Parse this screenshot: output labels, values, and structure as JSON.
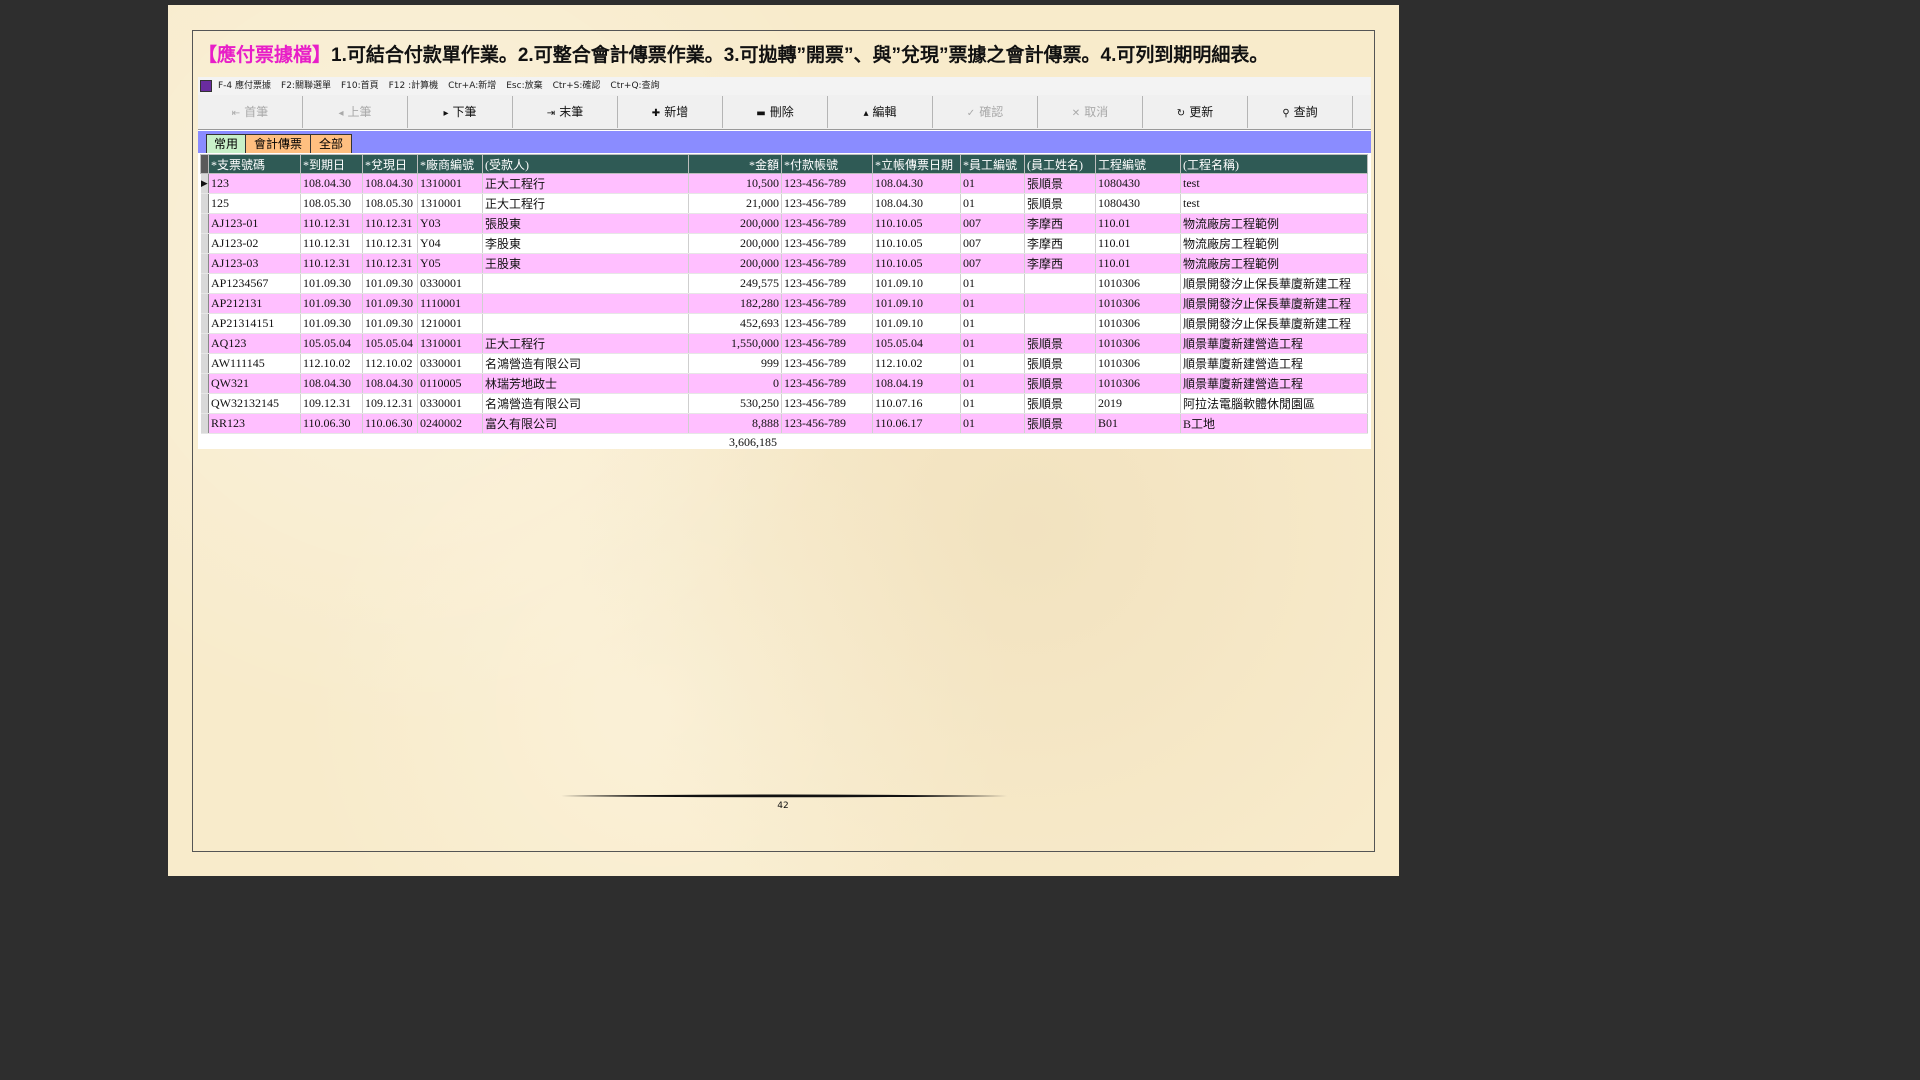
{
  "headline": {
    "tag": "【應付票據檔】",
    "text": "1.可結合付款單作業。2.可整合會計傳票作業。3.可拋轉”開票”、與”兌現”票據之會計傳票。4.可列到期明細表。"
  },
  "app_title": [
    "F-4 應付票據",
    "F2:關聯選單",
    "F10:首頁",
    "F12 :計算機",
    "Ctr+A:新增",
    "Esc:放棄",
    "Ctr+S:確認",
    "Ctr+Q:查詢"
  ],
  "toolbar": [
    {
      "label": "首筆",
      "icon": "⇤",
      "enabled": false
    },
    {
      "label": "上筆",
      "icon": "◂",
      "enabled": false
    },
    {
      "label": "下筆",
      "icon": "▸",
      "enabled": true
    },
    {
      "label": "末筆",
      "icon": "⇥",
      "enabled": true
    },
    {
      "label": "新增",
      "icon": "✚",
      "enabled": true
    },
    {
      "label": "刪除",
      "icon": "▬",
      "enabled": true
    },
    {
      "label": "編輯",
      "icon": "▴",
      "enabled": true
    },
    {
      "label": "確認",
      "icon": "✓",
      "enabled": false
    },
    {
      "label": "取消",
      "icon": "✕",
      "enabled": false
    },
    {
      "label": "更新",
      "icon": "↻",
      "enabled": true
    },
    {
      "label": "查詢",
      "icon": "⚲",
      "enabled": true
    }
  ],
  "tabs": [
    {
      "label": "常用",
      "active": true
    },
    {
      "label": "會計傳票",
      "active": false
    },
    {
      "label": "全部",
      "active": false
    }
  ],
  "columns": [
    "*支票號碼",
    "*到期日",
    "*兌現日",
    "*廠商編號",
    "(受款人)",
    "*金額",
    "*付款帳號",
    "*立帳傳票日期",
    "*員工編號",
    "(員工姓名)",
    "工程編號",
    "(工程名稱)"
  ],
  "rows": [
    [
      "123",
      "108.04.30",
      "108.04.30",
      "1310001",
      "正大工程行",
      "10,500",
      "123-456-789",
      "108.04.30",
      "01",
      "張順景",
      "1080430",
      "test"
    ],
    [
      "125",
      "108.05.30",
      "108.05.30",
      "1310001",
      "正大工程行",
      "21,000",
      "123-456-789",
      "108.04.30",
      "01",
      "張順景",
      "1080430",
      "test"
    ],
    [
      "AJ123-01",
      "110.12.31",
      "110.12.31",
      "Y03",
      "張股東",
      "200,000",
      "123-456-789",
      "110.10.05",
      "007",
      "李摩西",
      "110.01",
      "物流廠房工程範例"
    ],
    [
      "AJ123-02",
      "110.12.31",
      "110.12.31",
      "Y04",
      "李股東",
      "200,000",
      "123-456-789",
      "110.10.05",
      "007",
      "李摩西",
      "110.01",
      "物流廠房工程範例"
    ],
    [
      "AJ123-03",
      "110.12.31",
      "110.12.31",
      "Y05",
      "王股東",
      "200,000",
      "123-456-789",
      "110.10.05",
      "007",
      "李摩西",
      "110.01",
      "物流廠房工程範例"
    ],
    [
      "AP1234567",
      "101.09.30",
      "101.09.30",
      "0330001",
      "",
      "249,575",
      "123-456-789",
      "101.09.10",
      "01",
      "",
      "1010306",
      "順景開發汐止保長華廈新建工程"
    ],
    [
      "AP212131",
      "101.09.30",
      "101.09.30",
      "1110001",
      "",
      "182,280",
      "123-456-789",
      "101.09.10",
      "01",
      "",
      "1010306",
      "順景開發汐止保長華廈新建工程"
    ],
    [
      "AP21314151",
      "101.09.30",
      "101.09.30",
      "1210001",
      "",
      "452,693",
      "123-456-789",
      "101.09.10",
      "01",
      "",
      "1010306",
      "順景開發汐止保長華廈新建工程"
    ],
    [
      "AQ123",
      "105.05.04",
      "105.05.04",
      "1310001",
      "正大工程行",
      "1,550,000",
      "123-456-789",
      "105.05.04",
      "01",
      "張順景",
      "1010306",
      "順景華廈新建營造工程"
    ],
    [
      "AW111145",
      "112.10.02",
      "112.10.02",
      "0330001",
      "名鴻營造有限公司",
      "999",
      "123-456-789",
      "112.10.02",
      "01",
      "張順景",
      "1010306",
      "順景華廈新建營造工程"
    ],
    [
      "QW321",
      "108.04.30",
      "108.04.30",
      "0110005",
      "林瑞芳地政士",
      "0",
      "123-456-789",
      "108.04.19",
      "01",
      "張順景",
      "1010306",
      "順景華廈新建營造工程"
    ],
    [
      "QW32132145",
      "109.12.31",
      "109.12.31",
      "0330001",
      "名鴻營造有限公司",
      "530,250",
      "123-456-789",
      "110.07.16",
      "01",
      "張順景",
      "2019",
      "阿拉法電腦軟體休閒園區"
    ],
    [
      "RR123",
      "110.06.30",
      "110.06.30",
      "0240002",
      "富久有限公司",
      "8,888",
      "123-456-789",
      "110.06.17",
      "01",
      "張順景",
      "B01",
      "B工地"
    ]
  ],
  "total": "3,606,185",
  "page_number": "42",
  "colors": {
    "row_pink": "#ffbfff",
    "header": "#2f5a55",
    "tabbar": "#8a8cff",
    "tag": "#e81ec8"
  }
}
